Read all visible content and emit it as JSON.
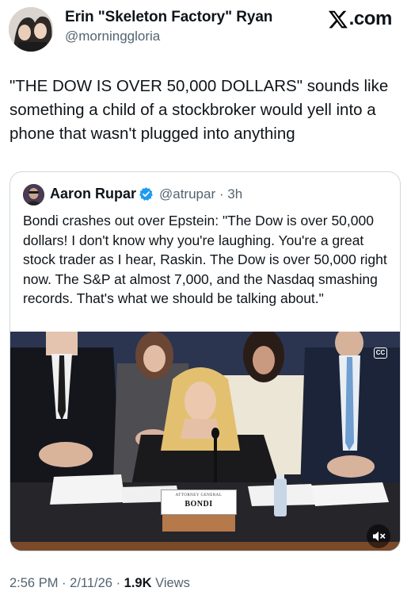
{
  "author": {
    "name": "Erin \"Skeleton Factory\" Ryan",
    "handle": "@morninggloria"
  },
  "brand": {
    "label": ".com"
  },
  "tweet": {
    "text": "\"THE DOW IS OVER 50,000 DOLLARS\" sounds like something a child of a stockbroker would yell into a phone that wasn't plugged into anything"
  },
  "quote": {
    "name": "Aaron Rupar",
    "handle": "@atrupar",
    "separator": "·",
    "time": "3h",
    "text": "Bondi crashes out over Epstein: \"The Dow is over 50,000 dollars! I don't know why you're laughing. You're a great stock trader as I hear, Raskin. The Dow is over 50,000 right now. The S&P at almost 7,000, and the Nasdaq smashing records. That's what we should be talking about.\"",
    "media": {
      "cc_label": "CC",
      "placard_title": "ATTORNEY GENERAL",
      "placard_name": "BONDI"
    }
  },
  "footer": {
    "time": "2:56 PM",
    "sep1": "·",
    "date": "2/11/26",
    "sep2": "·",
    "views_count": "1.9K",
    "views_label": "Views"
  },
  "icons": {
    "brand": "x-logo-icon",
    "verified": "verified-badge-icon",
    "cc": "closed-captions-icon",
    "mute": "muted-speaker-icon"
  },
  "colors": {
    "text": "#0f1419",
    "secondary": "#536471",
    "verified": "#1d9bf0",
    "border": "#cfd9de"
  }
}
